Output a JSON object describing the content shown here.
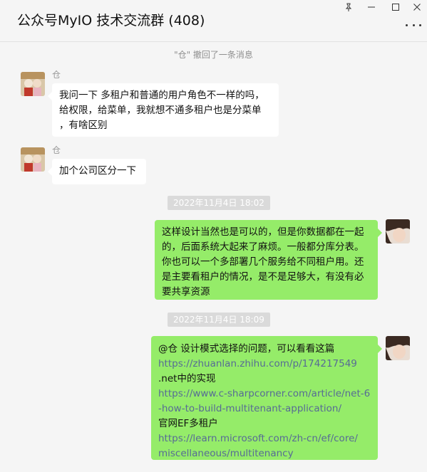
{
  "window": {
    "title": "公众号MyIO 技术交流群 (408)",
    "controls": {
      "pin": "⊥",
      "minimize": "—",
      "maximize": "□",
      "close": "✕"
    }
  },
  "chat": {
    "recall_notice": "\"仓\" 撤回了一条消息",
    "messages": [
      {
        "sender": "仓",
        "lines": [
          "我问一下 多租户和普通的用户角色不一样的吗，",
          "给权限，给菜单，我就想不通多租户也是分菜单",
          "，有啥区别"
        ]
      },
      {
        "sender": "仓",
        "lines": [
          "加个公司区分一下"
        ]
      },
      {
        "timestamp": "2022年11月4日 18:02",
        "lines": [
          "这样设计当然也是可以的，但是你数据都在一起",
          "的，后面系统大起来了麻烦。一般都分库分表。",
          "你也可以一个多部署几个服务给不同租户用。还",
          "是主要看租户的情况，是不是足够大，有没有必",
          "要共享资源"
        ]
      },
      {
        "timestamp": "2022年11月4日 18:09",
        "lines": [
          "@仓 设计模式选择的问题，可以看看这篇",
          "https://zhuanlan.zhihu.com/p/174217549",
          ".net中的实现",
          "https://www.c-sharpcorner.com/article/net-6",
          "-how-to-build-multitenant-application/",
          "官网EF多租户",
          "https://learn.microsoft.com/zh-cn/ef/core/",
          "miscellaneous/multitenancy"
        ]
      }
    ]
  },
  "colors": {
    "outgoing_bubble": "#95ec69",
    "incoming_bubble": "#ffffff",
    "link": "#576b95"
  }
}
